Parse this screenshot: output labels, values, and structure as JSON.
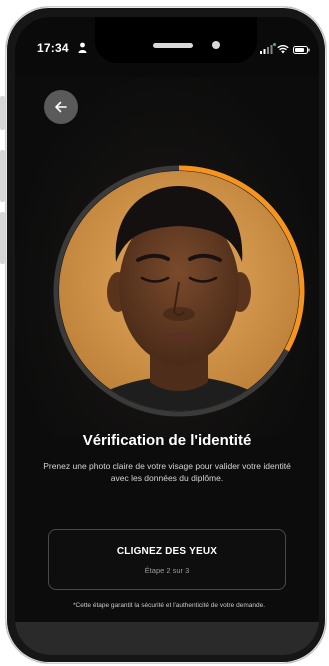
{
  "status_bar": {
    "time": "17:34",
    "icons": [
      "person-icon",
      "signal-icon",
      "wifi-icon",
      "battery-icon"
    ]
  },
  "header": {
    "back_icon": "arrow-left-icon"
  },
  "camera": {
    "progress": 0.33,
    "progress_color": "#f7941d",
    "ring_color": "#3a3a3a"
  },
  "main": {
    "title": "Vérification de l'identité",
    "subtitle": "Prenez une photo claire de votre visage pour valider votre identité avec les données du diplôme."
  },
  "step": {
    "instruction": "CLIGNEZ DES YEUX",
    "progress_text": "Étape 2 sur 3"
  },
  "footer": {
    "note": "*Cette étape garantit la sécurité et l'authenticité de votre demande."
  },
  "colors": {
    "accent": "#f7941d",
    "background": "#0c0c0c",
    "text": "#ffffff"
  }
}
